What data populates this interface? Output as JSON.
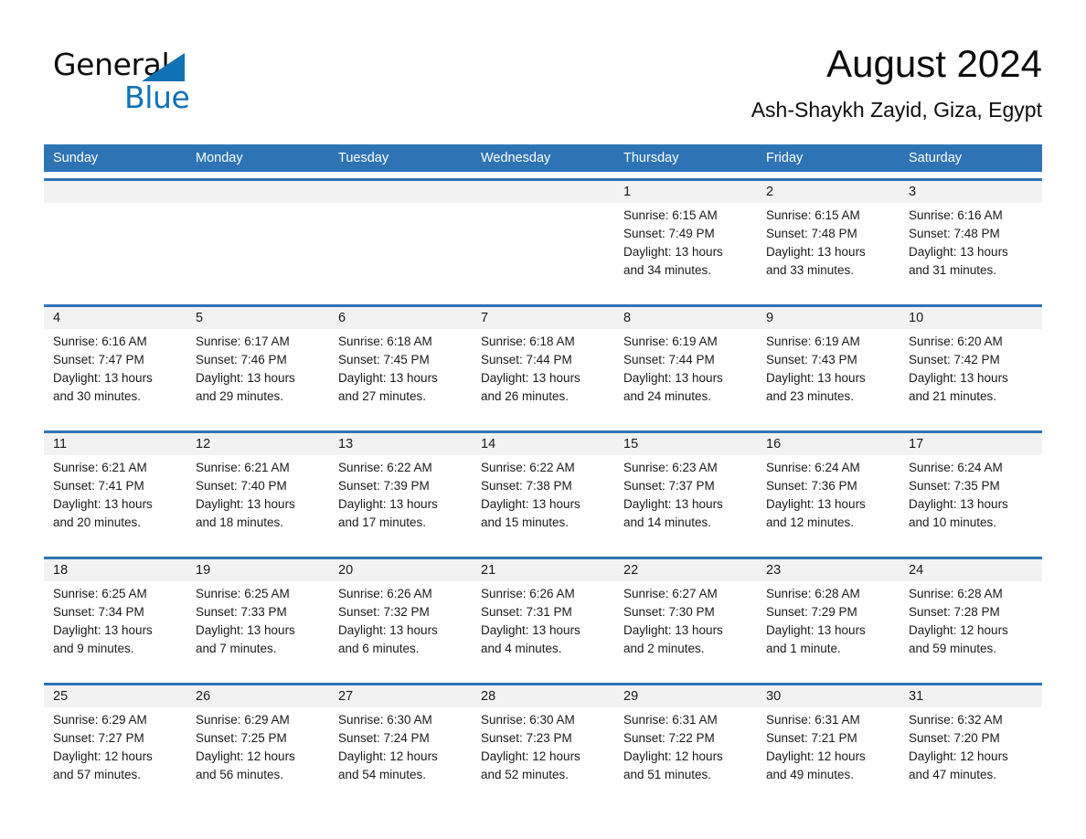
{
  "brand": {
    "name_part1": "General",
    "name_part2": "Blue",
    "triangle_icon": "triangle-logo-icon",
    "accent_color": "#1272B6"
  },
  "header": {
    "title": "August 2024",
    "location": "Ash-Shaykh Zayid, Giza, Egypt"
  },
  "theme": {
    "header_blue": "#2E74B5",
    "date_band_gray": "#F2F2F2",
    "text_dark": "#1a1a1a"
  },
  "weekdays": [
    "Sunday",
    "Monday",
    "Tuesday",
    "Wednesday",
    "Thursday",
    "Friday",
    "Saturday"
  ],
  "weeks": [
    {
      "days": [
        {
          "num": "",
          "sunrise": "",
          "sunset": "",
          "daylight_line1": "",
          "daylight_line2": "",
          "empty": true
        },
        {
          "num": "",
          "sunrise": "",
          "sunset": "",
          "daylight_line1": "",
          "daylight_line2": "",
          "empty": true
        },
        {
          "num": "",
          "sunrise": "",
          "sunset": "",
          "daylight_line1": "",
          "daylight_line2": "",
          "empty": true
        },
        {
          "num": "",
          "sunrise": "",
          "sunset": "",
          "daylight_line1": "",
          "daylight_line2": "",
          "empty": true
        },
        {
          "num": "1",
          "sunrise": "Sunrise: 6:15 AM",
          "sunset": "Sunset: 7:49 PM",
          "daylight_line1": "Daylight: 13 hours",
          "daylight_line2": "and 34 minutes.",
          "empty": false
        },
        {
          "num": "2",
          "sunrise": "Sunrise: 6:15 AM",
          "sunset": "Sunset: 7:48 PM",
          "daylight_line1": "Daylight: 13 hours",
          "daylight_line2": "and 33 minutes.",
          "empty": false
        },
        {
          "num": "3",
          "sunrise": "Sunrise: 6:16 AM",
          "sunset": "Sunset: 7:48 PM",
          "daylight_line1": "Daylight: 13 hours",
          "daylight_line2": "and 31 minutes.",
          "empty": false
        }
      ]
    },
    {
      "days": [
        {
          "num": "4",
          "sunrise": "Sunrise: 6:16 AM",
          "sunset": "Sunset: 7:47 PM",
          "daylight_line1": "Daylight: 13 hours",
          "daylight_line2": "and 30 minutes.",
          "empty": false
        },
        {
          "num": "5",
          "sunrise": "Sunrise: 6:17 AM",
          "sunset": "Sunset: 7:46 PM",
          "daylight_line1": "Daylight: 13 hours",
          "daylight_line2": "and 29 minutes.",
          "empty": false
        },
        {
          "num": "6",
          "sunrise": "Sunrise: 6:18 AM",
          "sunset": "Sunset: 7:45 PM",
          "daylight_line1": "Daylight: 13 hours",
          "daylight_line2": "and 27 minutes.",
          "empty": false
        },
        {
          "num": "7",
          "sunrise": "Sunrise: 6:18 AM",
          "sunset": "Sunset: 7:44 PM",
          "daylight_line1": "Daylight: 13 hours",
          "daylight_line2": "and 26 minutes.",
          "empty": false
        },
        {
          "num": "8",
          "sunrise": "Sunrise: 6:19 AM",
          "sunset": "Sunset: 7:44 PM",
          "daylight_line1": "Daylight: 13 hours",
          "daylight_line2": "and 24 minutes.",
          "empty": false
        },
        {
          "num": "9",
          "sunrise": "Sunrise: 6:19 AM",
          "sunset": "Sunset: 7:43 PM",
          "daylight_line1": "Daylight: 13 hours",
          "daylight_line2": "and 23 minutes.",
          "empty": false
        },
        {
          "num": "10",
          "sunrise": "Sunrise: 6:20 AM",
          "sunset": "Sunset: 7:42 PM",
          "daylight_line1": "Daylight: 13 hours",
          "daylight_line2": "and 21 minutes.",
          "empty": false
        }
      ]
    },
    {
      "days": [
        {
          "num": "11",
          "sunrise": "Sunrise: 6:21 AM",
          "sunset": "Sunset: 7:41 PM",
          "daylight_line1": "Daylight: 13 hours",
          "daylight_line2": "and 20 minutes.",
          "empty": false
        },
        {
          "num": "12",
          "sunrise": "Sunrise: 6:21 AM",
          "sunset": "Sunset: 7:40 PM",
          "daylight_line1": "Daylight: 13 hours",
          "daylight_line2": "and 18 minutes.",
          "empty": false
        },
        {
          "num": "13",
          "sunrise": "Sunrise: 6:22 AM",
          "sunset": "Sunset: 7:39 PM",
          "daylight_line1": "Daylight: 13 hours",
          "daylight_line2": "and 17 minutes.",
          "empty": false
        },
        {
          "num": "14",
          "sunrise": "Sunrise: 6:22 AM",
          "sunset": "Sunset: 7:38 PM",
          "daylight_line1": "Daylight: 13 hours",
          "daylight_line2": "and 15 minutes.",
          "empty": false
        },
        {
          "num": "15",
          "sunrise": "Sunrise: 6:23 AM",
          "sunset": "Sunset: 7:37 PM",
          "daylight_line1": "Daylight: 13 hours",
          "daylight_line2": "and 14 minutes.",
          "empty": false
        },
        {
          "num": "16",
          "sunrise": "Sunrise: 6:24 AM",
          "sunset": "Sunset: 7:36 PM",
          "daylight_line1": "Daylight: 13 hours",
          "daylight_line2": "and 12 minutes.",
          "empty": false
        },
        {
          "num": "17",
          "sunrise": "Sunrise: 6:24 AM",
          "sunset": "Sunset: 7:35 PM",
          "daylight_line1": "Daylight: 13 hours",
          "daylight_line2": "and 10 minutes.",
          "empty": false
        }
      ]
    },
    {
      "days": [
        {
          "num": "18",
          "sunrise": "Sunrise: 6:25 AM",
          "sunset": "Sunset: 7:34 PM",
          "daylight_line1": "Daylight: 13 hours",
          "daylight_line2": "and 9 minutes.",
          "empty": false
        },
        {
          "num": "19",
          "sunrise": "Sunrise: 6:25 AM",
          "sunset": "Sunset: 7:33 PM",
          "daylight_line1": "Daylight: 13 hours",
          "daylight_line2": "and 7 minutes.",
          "empty": false
        },
        {
          "num": "20",
          "sunrise": "Sunrise: 6:26 AM",
          "sunset": "Sunset: 7:32 PM",
          "daylight_line1": "Daylight: 13 hours",
          "daylight_line2": "and 6 minutes.",
          "empty": false
        },
        {
          "num": "21",
          "sunrise": "Sunrise: 6:26 AM",
          "sunset": "Sunset: 7:31 PM",
          "daylight_line1": "Daylight: 13 hours",
          "daylight_line2": "and 4 minutes.",
          "empty": false
        },
        {
          "num": "22",
          "sunrise": "Sunrise: 6:27 AM",
          "sunset": "Sunset: 7:30 PM",
          "daylight_line1": "Daylight: 13 hours",
          "daylight_line2": "and 2 minutes.",
          "empty": false
        },
        {
          "num": "23",
          "sunrise": "Sunrise: 6:28 AM",
          "sunset": "Sunset: 7:29 PM",
          "daylight_line1": "Daylight: 13 hours",
          "daylight_line2": "and 1 minute.",
          "empty": false
        },
        {
          "num": "24",
          "sunrise": "Sunrise: 6:28 AM",
          "sunset": "Sunset: 7:28 PM",
          "daylight_line1": "Daylight: 12 hours",
          "daylight_line2": "and 59 minutes.",
          "empty": false
        }
      ]
    },
    {
      "days": [
        {
          "num": "25",
          "sunrise": "Sunrise: 6:29 AM",
          "sunset": "Sunset: 7:27 PM",
          "daylight_line1": "Daylight: 12 hours",
          "daylight_line2": "and 57 minutes.",
          "empty": false
        },
        {
          "num": "26",
          "sunrise": "Sunrise: 6:29 AM",
          "sunset": "Sunset: 7:25 PM",
          "daylight_line1": "Daylight: 12 hours",
          "daylight_line2": "and 56 minutes.",
          "empty": false
        },
        {
          "num": "27",
          "sunrise": "Sunrise: 6:30 AM",
          "sunset": "Sunset: 7:24 PM",
          "daylight_line1": "Daylight: 12 hours",
          "daylight_line2": "and 54 minutes.",
          "empty": false
        },
        {
          "num": "28",
          "sunrise": "Sunrise: 6:30 AM",
          "sunset": "Sunset: 7:23 PM",
          "daylight_line1": "Daylight: 12 hours",
          "daylight_line2": "and 52 minutes.",
          "empty": false
        },
        {
          "num": "29",
          "sunrise": "Sunrise: 6:31 AM",
          "sunset": "Sunset: 7:22 PM",
          "daylight_line1": "Daylight: 12 hours",
          "daylight_line2": "and 51 minutes.",
          "empty": false
        },
        {
          "num": "30",
          "sunrise": "Sunrise: 6:31 AM",
          "sunset": "Sunset: 7:21 PM",
          "daylight_line1": "Daylight: 12 hours",
          "daylight_line2": "and 49 minutes.",
          "empty": false
        },
        {
          "num": "31",
          "sunrise": "Sunrise: 6:32 AM",
          "sunset": "Sunset: 7:20 PM",
          "daylight_line1": "Daylight: 12 hours",
          "daylight_line2": "and 47 minutes.",
          "empty": false
        }
      ]
    }
  ]
}
